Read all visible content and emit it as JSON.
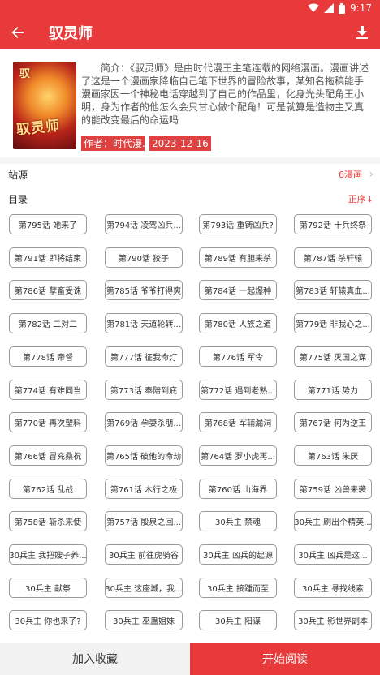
{
  "status": {
    "time": "9:17"
  },
  "appbar": {
    "title": "驭灵师"
  },
  "comic": {
    "cover_top_text": "驭",
    "cover_title_text": "驭灵师",
    "description": "简介：《驭灵师》是由时代漫王主笔连载的网络漫画。漫画讲述了这是一个漫画家降临自己笔下世界的冒险故事，某知名拖稿能手漫画家因一个神秘电话穿越到了自己的作品里，化身光头配角王小明，身为作者的他怎么会只甘心做个配角！可是就算是造物主又真的能改变最后的命运吗",
    "author_tag": "作者：时代漫...",
    "date_tag": "2023-12-16"
  },
  "source": {
    "label": "站源",
    "value": "6漫画"
  },
  "toc": {
    "label": "目录",
    "order": "正序↓"
  },
  "chapters": [
    "第795话 她来了",
    "第794话 凌驾凶兵...",
    "第793话 重铸凶兵?",
    "第792话 十兵终祭",
    "第791话 即将结束",
    "第790话 狡子",
    "第789话 有胆来杀",
    "第787话 杀轩辕",
    "第786话 孽畜受诛",
    "第785话 爷爷打得爽",
    "第784话 一起爆种",
    "第783话 轩辕真血...",
    "第782话 二对二",
    "第781话 天道轮转...",
    "第780话 人族之道",
    "第779话 非我心之...",
    "第778话 帝督",
    "第777话 征我命灯",
    "第776话 军令",
    "第775话 灭国之谋",
    "第774话 有难同当",
    "第773话 奉陪到底",
    "第772话 遇到老熟...",
    "第771话 势力",
    "第770话 再次塑料",
    "第769话 孕妻杀朋...",
    "第768话 军辅漏洞",
    "第767话 何为逆王",
    "第766话 冒充桑祝",
    "第765话 破他的命劫",
    "第764话 罗小虎再...",
    "第763话 朱厌",
    "第762话 乱战",
    "第761话 木行之极",
    "第760话 山海界",
    "第759话 凶兽来袭",
    "第758话 斩杀来使",
    "第757话 殷泉之回...",
    "30兵主 禁魂",
    "30兵主 刷出个精英...",
    "30兵主 我把嫂子养...",
    "30兵主 前往虎骑谷",
    "30兵主 凶兵的起源",
    "30兵主 凶兵是这...",
    "30兵主 献祭",
    "30兵主 这座城，我...",
    "30兵主 接踵而至",
    "30兵主 寻找线索",
    "30兵主 你也来了?",
    "30兵主 巫蛊姐妹",
    "30兵主 阳谋",
    "30兵主 影世界副本"
  ],
  "bottom": {
    "favorite": "加入收藏",
    "read": "开始阅读"
  },
  "colors": {
    "accent": "#e83a3a"
  }
}
